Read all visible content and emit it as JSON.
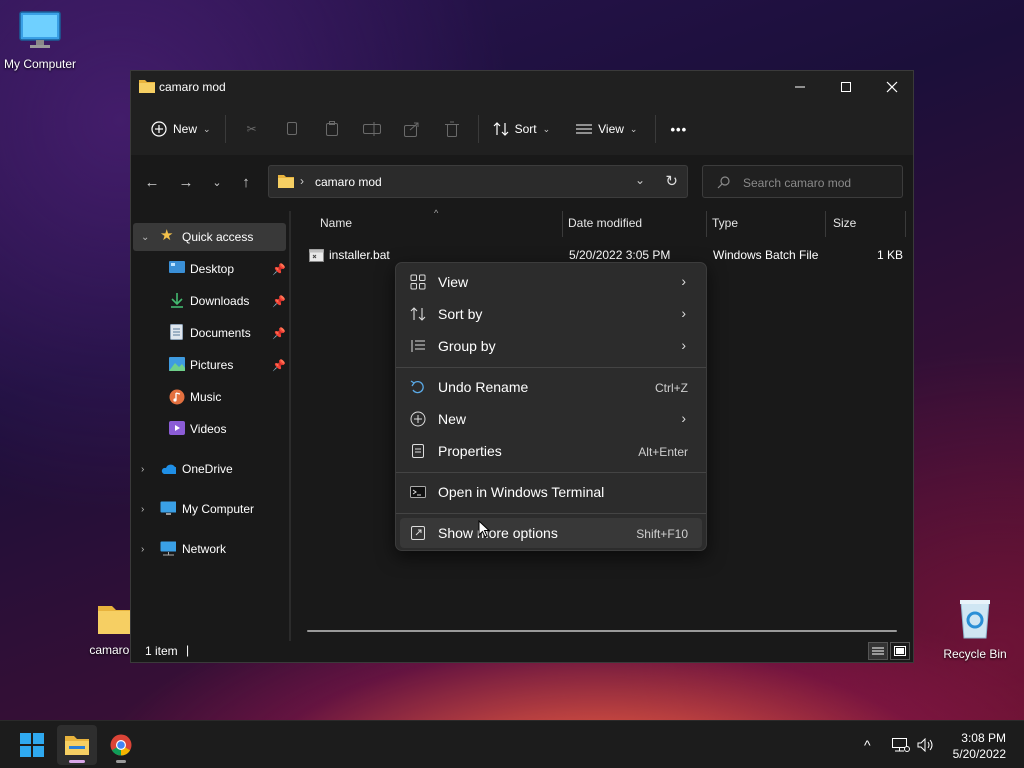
{
  "desktop": {
    "icons": [
      {
        "label": "My Computer"
      },
      {
        "label": "camaro m"
      },
      {
        "label": "Recycle Bin"
      }
    ]
  },
  "window": {
    "title": "camaro mod",
    "toolbar": {
      "new_label": "New",
      "sort_label": "Sort",
      "view_label": "View",
      "more_label": "•••"
    },
    "address": {
      "separator": "›",
      "crumb": "camaro mod"
    },
    "search": {
      "placeholder": "Search camaro mod"
    },
    "sidebar": {
      "items": [
        {
          "label": "Quick access",
          "icon": "star-icon"
        },
        {
          "label": "Desktop",
          "icon": "desktop-icon"
        },
        {
          "label": "Downloads",
          "icon": "download-icon"
        },
        {
          "label": "Documents",
          "icon": "documents-icon"
        },
        {
          "label": "Pictures",
          "icon": "pictures-icon"
        },
        {
          "label": "Music",
          "icon": "music-icon"
        },
        {
          "label": "Videos",
          "icon": "videos-icon"
        },
        {
          "label": "OneDrive",
          "icon": "cloud-icon"
        },
        {
          "label": "My Computer",
          "icon": "computer-icon"
        },
        {
          "label": "Network",
          "icon": "network-icon"
        }
      ]
    },
    "columns": {
      "name": "Name",
      "date": "Date modified",
      "type": "Type",
      "size": "Size"
    },
    "files": [
      {
        "name": "installer.bat",
        "date": "5/20/2022 3:05 PM",
        "type": "Windows Batch File",
        "size": "1 KB"
      }
    ],
    "status": {
      "count": "1 item",
      "divider": "|"
    }
  },
  "context_menu": {
    "items": [
      {
        "label": "View",
        "icon": "grid-icon"
      },
      {
        "label": "Sort by",
        "icon": "sort-icon"
      },
      {
        "label": "Group by",
        "icon": "group-icon"
      },
      {
        "label": "Undo Rename",
        "icon": "undo-icon",
        "shortcut": "Ctrl+Z"
      },
      {
        "label": "New",
        "icon": "plus-circle-icon"
      },
      {
        "label": "Properties",
        "icon": "properties-icon",
        "shortcut": "Alt+Enter"
      },
      {
        "label": "Open in Windows Terminal",
        "icon": "terminal-icon"
      },
      {
        "label": "Show more options",
        "icon": "more-options-icon",
        "shortcut": "Shift+F10"
      }
    ]
  },
  "taskbar": {
    "time": "3:08 PM",
    "date": "5/20/2022"
  },
  "colors": {
    "accent": "#0078d4",
    "folder": "#f3c14b",
    "window_bg": "#191919",
    "menu_bg": "#2c2c2c"
  }
}
